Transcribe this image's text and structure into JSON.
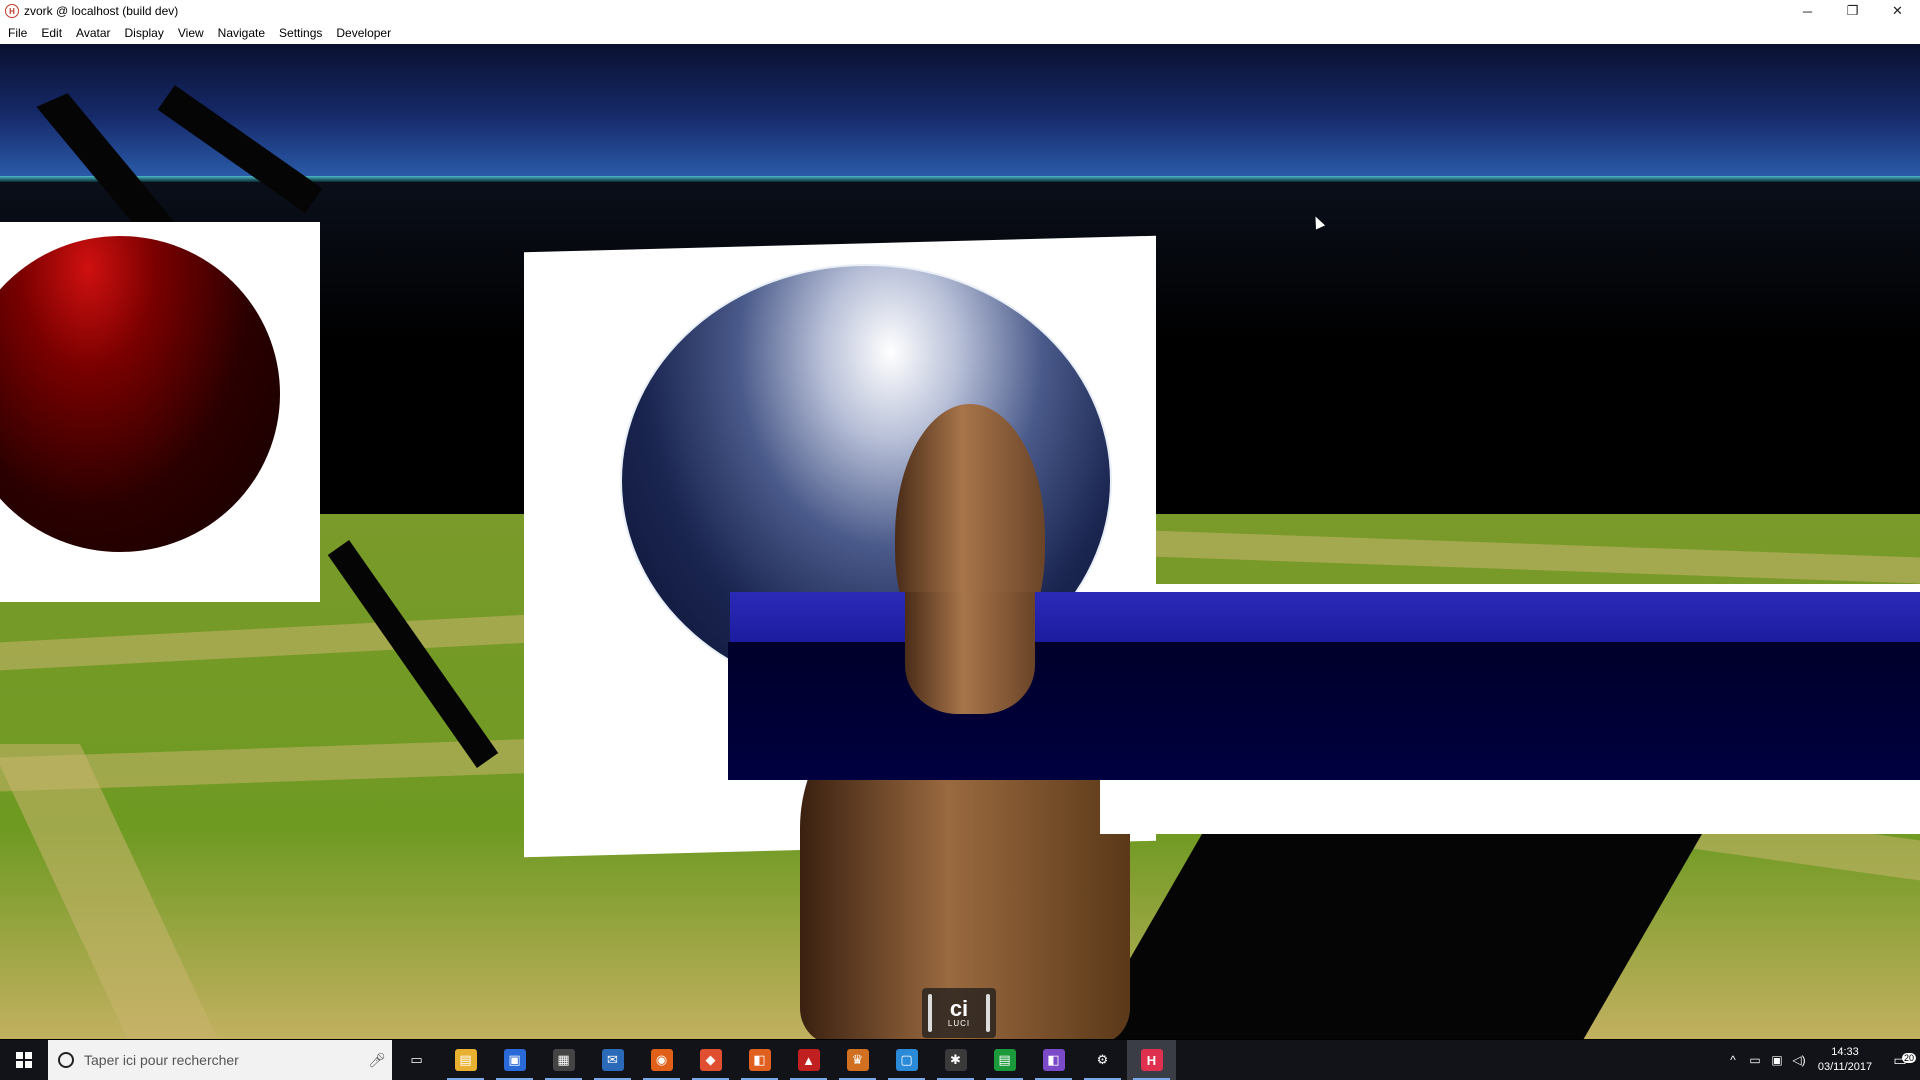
{
  "window": {
    "title": "zvork @ localhost (build dev)",
    "controls": {
      "minimize": "─",
      "restore": "❐",
      "close": "✕"
    }
  },
  "menu": [
    "File",
    "Edit",
    "Avatar",
    "Display",
    "View",
    "Navigate",
    "Settings",
    "Developer"
  ],
  "overlay": {
    "badge_main": "ci",
    "badge_sub": "LUCI"
  },
  "taskbar": {
    "search_placeholder": "Taper ici pour rechercher",
    "apps": [
      {
        "name": "task-view-icon",
        "glyph": "▭",
        "color": "#111318"
      },
      {
        "name": "file-explorer-icon",
        "glyph": "▤",
        "color": "#e8b030"
      },
      {
        "name": "store-icon",
        "glyph": "▣",
        "color": "#2a6ad8"
      },
      {
        "name": "calculator-icon",
        "glyph": "▦",
        "color": "#444"
      },
      {
        "name": "thunderbird-icon",
        "glyph": "✉",
        "color": "#2a6ab8"
      },
      {
        "name": "firefox-icon",
        "glyph": "◉",
        "color": "#e0601a"
      },
      {
        "name": "git-icon",
        "glyph": "◆",
        "color": "#e05030"
      },
      {
        "name": "visual-studio-code-icon",
        "glyph": "◧",
        "color": "#e06020"
      },
      {
        "name": "triangle-app-icon",
        "glyph": "▲",
        "color": "#c02020"
      },
      {
        "name": "crown-app-icon",
        "glyph": "♛",
        "color": "#d07020"
      },
      {
        "name": "window-app-icon",
        "glyph": "▢",
        "color": "#2a8ad8"
      },
      {
        "name": "slack-icon",
        "glyph": "✱",
        "color": "#3a3a3a"
      },
      {
        "name": "spreadsheet-icon",
        "glyph": "▤",
        "color": "#1a9a3a"
      },
      {
        "name": "visual-studio-icon",
        "glyph": "◧",
        "color": "#7a4ac8"
      },
      {
        "name": "settings-icon",
        "glyph": "⚙",
        "color": "#111318"
      },
      {
        "name": "interface-app-icon",
        "glyph": "H",
        "color": "#e03050"
      }
    ],
    "tray": {
      "up_arrow": "^",
      "time": "14:33",
      "date": "03/11/2017",
      "notifications": "20"
    }
  }
}
